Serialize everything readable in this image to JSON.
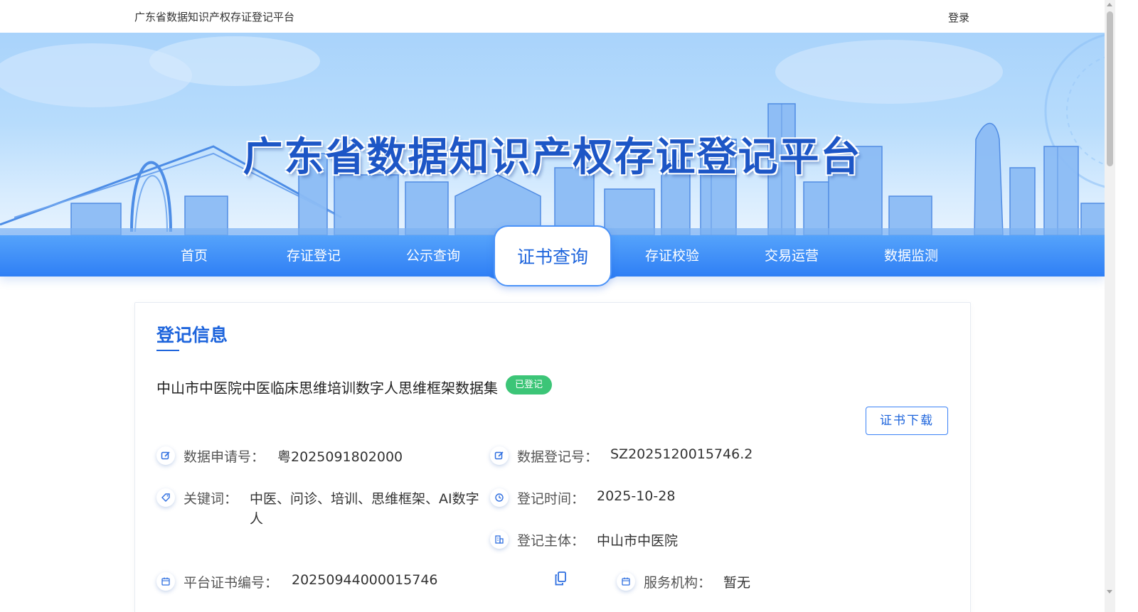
{
  "header": {
    "site_name": "广东省数据知识产权存证登记平台",
    "login_label": "登录"
  },
  "banner": {
    "title": "广东省数据知识产权存证登记平台"
  },
  "nav": {
    "items": [
      {
        "label": "首页"
      },
      {
        "label": "存证登记"
      },
      {
        "label": "公示查询"
      },
      {
        "label": "证书查询",
        "active": true
      },
      {
        "label": "存证校验"
      },
      {
        "label": "交易运营"
      },
      {
        "label": "数据监测"
      }
    ]
  },
  "record": {
    "section_title": "登记信息",
    "title": "中山市中医院中医临床思维培训数字人思维框架数据集",
    "status": "已登记",
    "download_label": "证书下载",
    "fields": {
      "application_no": {
        "label": "数据申请号：",
        "value": "粤2025091802000"
      },
      "registration_no": {
        "label": "数据登记号：",
        "value": "SZ2025120015746.2"
      },
      "keywords": {
        "label": "关键词：",
        "value_line1": "中医、问诊、培训、思维框架、AI数字",
        "value_line2": "人"
      },
      "registration_time": {
        "label": "登记时间：",
        "value": "2025-10-28"
      },
      "registrant": {
        "label": "登记主体：",
        "value": "中山市中医院"
      },
      "certificate_no": {
        "label": "平台证书编号：",
        "value": "20250944000015746"
      },
      "service_agency": {
        "label": "服务机构：",
        "value": "暂无"
      }
    }
  },
  "colors": {
    "primary": "#1d64dc",
    "status_green": "#3cc577",
    "nav_blue": "#2f7ff5"
  }
}
